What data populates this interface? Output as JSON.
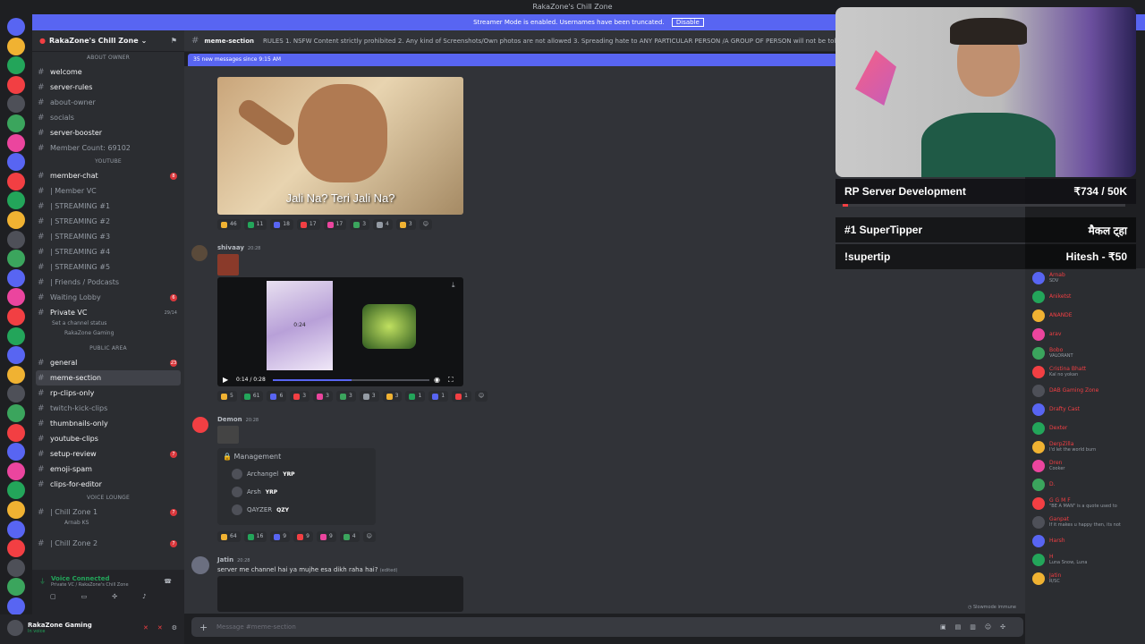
{
  "window": {
    "title": "RakaZone's Chill Zone"
  },
  "banner": {
    "text": "Streamer Mode is enabled. Usernames have been truncated.",
    "button": "Disable"
  },
  "server": {
    "name": "RakaZone's Chill Zone"
  },
  "sections": [
    {
      "title": "About Owner",
      "channels": [
        {
          "name": "welcome",
          "state": "unread"
        },
        {
          "name": "server-rules",
          "state": "unread"
        },
        {
          "name": "about-owner",
          "state": "muted"
        },
        {
          "name": "socials",
          "state": "muted"
        },
        {
          "name": "server-booster",
          "state": "unread"
        },
        {
          "name": "Member Count: 69102",
          "state": "muted"
        }
      ]
    },
    {
      "title": "YOUTUBE",
      "channels": [
        {
          "name": "member-chat",
          "state": "unread",
          "badge": "8"
        },
        {
          "name": "| Member VC",
          "state": "muted"
        },
        {
          "name": "| STREAMING #1",
          "state": "muted"
        },
        {
          "name": "| STREAMING #2",
          "state": "muted"
        },
        {
          "name": "| STREAMING #3",
          "state": "muted"
        },
        {
          "name": "| STREAMING #4",
          "state": "muted"
        },
        {
          "name": "| STREAMING #5",
          "state": "muted"
        },
        {
          "name": "| Friends / Podcasts",
          "state": "muted"
        },
        {
          "name": "Waiting Lobby",
          "state": "muted",
          "badge": "6"
        },
        {
          "name": "Private VC",
          "state": "unread",
          "count": "29/14"
        }
      ]
    }
  ],
  "private_vc": {
    "status": "Set a channel status",
    "user": "RakaZone Gaming"
  },
  "public": {
    "title": "PUBLIC AREA",
    "channels": [
      {
        "name": "general",
        "state": "unread",
        "badge": "23"
      },
      {
        "name": "meme-section",
        "state": "selected"
      },
      {
        "name": "rp-clips-only",
        "state": "unread"
      },
      {
        "name": "twitch-kick-clips",
        "state": "muted"
      },
      {
        "name": "thumbnails-only",
        "state": "unread"
      },
      {
        "name": "youtube-clips",
        "state": "unread"
      },
      {
        "name": "setup-review",
        "state": "unread",
        "badge": "7"
      },
      {
        "name": "emoji-spam",
        "state": "unread"
      },
      {
        "name": "clips-for-editor",
        "state": "unread"
      }
    ]
  },
  "voice_lounge": {
    "title": "Voice Lounge",
    "channels": [
      {
        "name": "| Chill Zone 1",
        "badge": "7"
      },
      {
        "name": "Arnab KS",
        "sub": true
      },
      {
        "name": "| Chill Zone 2",
        "badge": "7"
      }
    ]
  },
  "voice": {
    "status": "Voice Connected",
    "location": "Private VC / RakaZone's Chill Zone"
  },
  "user": {
    "name": "RakaZone Gaming",
    "status": "In voice"
  },
  "channel": {
    "name": "meme-section",
    "topic": "RULES 1. NSFW Content strictly prohibited 2. Any kind of Screenshots/Own photos are not allowed 3. Spreading hate to ANY PARTICULAR PERSON /A GROUP OF PERSON will not be tolerated 4. Replying/ Reacting"
  },
  "new_messages": "35 new messages since 9:15 AM",
  "messages": [
    {
      "caption": "Jali Na? Teri Jali Na?",
      "reactions": [
        "46",
        "11",
        "18",
        "17",
        "17",
        "3",
        "4",
        "3"
      ]
    },
    {
      "user": "shivaay",
      "time": "20:28",
      "video_time": "0:14 / 0:28",
      "thumb_time": "0:24",
      "reactions": [
        "5",
        "61",
        "6",
        "3",
        "3",
        "3",
        "3",
        "3",
        "1",
        "1",
        "1"
      ]
    },
    {
      "user": "Demon",
      "time": "20:28",
      "card_title": "Management",
      "card_members": [
        {
          "name": "Archangel",
          "tag": "YRP"
        },
        {
          "name": "Arsh",
          "tag": "YRP"
        },
        {
          "name": "QAYZER",
          "tag": "QZY"
        }
      ],
      "reactions": [
        "64",
        "16",
        "9",
        "9",
        "9",
        "4"
      ]
    },
    {
      "user": "Jatin",
      "time": "20:28",
      "text": "server me channel hai ya mujhe esa dikh raha hai?",
      "edited": "(edited)"
    }
  ],
  "composer": {
    "placeholder": "Message #meme-section"
  },
  "slowmode": "Slowmode immune",
  "overlay": {
    "goal_title": "RP Server Development",
    "goal_value": "₹734 / 50K",
    "tipper_label": "#1 SuperTipper",
    "tipper_name": "मैकल ट्हा",
    "cmd": "!supertip",
    "cmd_value": "Hitesh - ₹50"
  },
  "members": [
    {
      "name": "Arnab",
      "status": "SDV",
      "color": "#f23f43"
    },
    {
      "name": "Aniketst",
      "status": "",
      "color": "#f23f43"
    },
    {
      "name": "ANANDE",
      "status": "",
      "color": "#f23f43"
    },
    {
      "name": "arav",
      "status": "",
      "color": "#f23f43"
    },
    {
      "name": "Bobo",
      "status": "VALORANT",
      "color": "#f23f43"
    },
    {
      "name": "Cristina Bhatt",
      "status": "Kal no yokan",
      "color": "#f23f43"
    },
    {
      "name": "DAB Gaming Zone",
      "status": "",
      "color": "#f23f43"
    },
    {
      "name": "Drafty Cast",
      "status": "",
      "color": "#f23f43"
    },
    {
      "name": "Dexter",
      "status": "",
      "color": "#f23f43"
    },
    {
      "name": "DerpZilla",
      "status": "I'd let the world burn",
      "color": "#f23f43"
    },
    {
      "name": "Dren",
      "status": "Cooker",
      "color": "#f23f43"
    },
    {
      "name": "D.",
      "status": "",
      "color": "#f23f43"
    },
    {
      "name": "G G M F",
      "status": "\"BE A MAN\" is a quote used to",
      "color": "#f23f43"
    },
    {
      "name": "Ganpat",
      "status": "If it makes u happy then, its not",
      "color": "#f23f43"
    },
    {
      "name": "Harsh",
      "status": "",
      "color": "#f23f43"
    },
    {
      "name": "H",
      "status": "Luna Snow, Luna",
      "color": "#f23f43"
    },
    {
      "name": "Jatin",
      "status": "R/SC",
      "color": "#f23f43"
    }
  ]
}
